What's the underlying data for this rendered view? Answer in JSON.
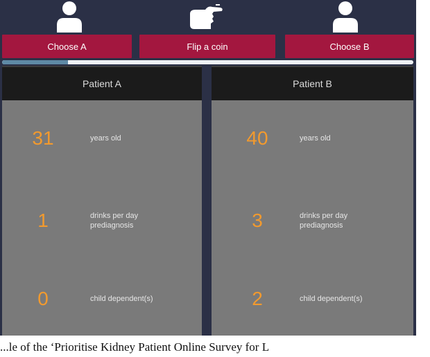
{
  "toolbar": {
    "choose_a_label": "Choose A",
    "flip_coin_label": "Flip a coin",
    "choose_b_label": "Choose B"
  },
  "progress": {
    "fraction": 0.16
  },
  "icons": {
    "left": "person-icon",
    "center": "pointing-hand-icon",
    "right": "person-icon"
  },
  "patients": [
    {
      "title": "Patient A",
      "attributes": [
        {
          "value": "31",
          "label_lines": [
            "years old"
          ]
        },
        {
          "value": "1",
          "label_lines": [
            "drinks per day",
            "prediagnosis"
          ]
        },
        {
          "value": "0",
          "label_lines": [
            "child dependent(s)"
          ]
        }
      ]
    },
    {
      "title": "Patient B",
      "attributes": [
        {
          "value": "40",
          "label_lines": [
            "years old"
          ]
        },
        {
          "value": "3",
          "label_lines": [
            "drinks per day",
            "prediagnosis"
          ]
        },
        {
          "value": "2",
          "label_lines": [
            "child dependent(s)"
          ]
        }
      ]
    }
  ],
  "caption": "...le of the ‘Prioritise Kidney Patient Online Survey for L",
  "colors": {
    "background": "#2b3046",
    "button": "#a3173f",
    "progress_fill": "#5f8aa6",
    "panel": "#7a7a7a",
    "panel_header": "#1b1b1b",
    "value_accent": "#f29a2e"
  }
}
